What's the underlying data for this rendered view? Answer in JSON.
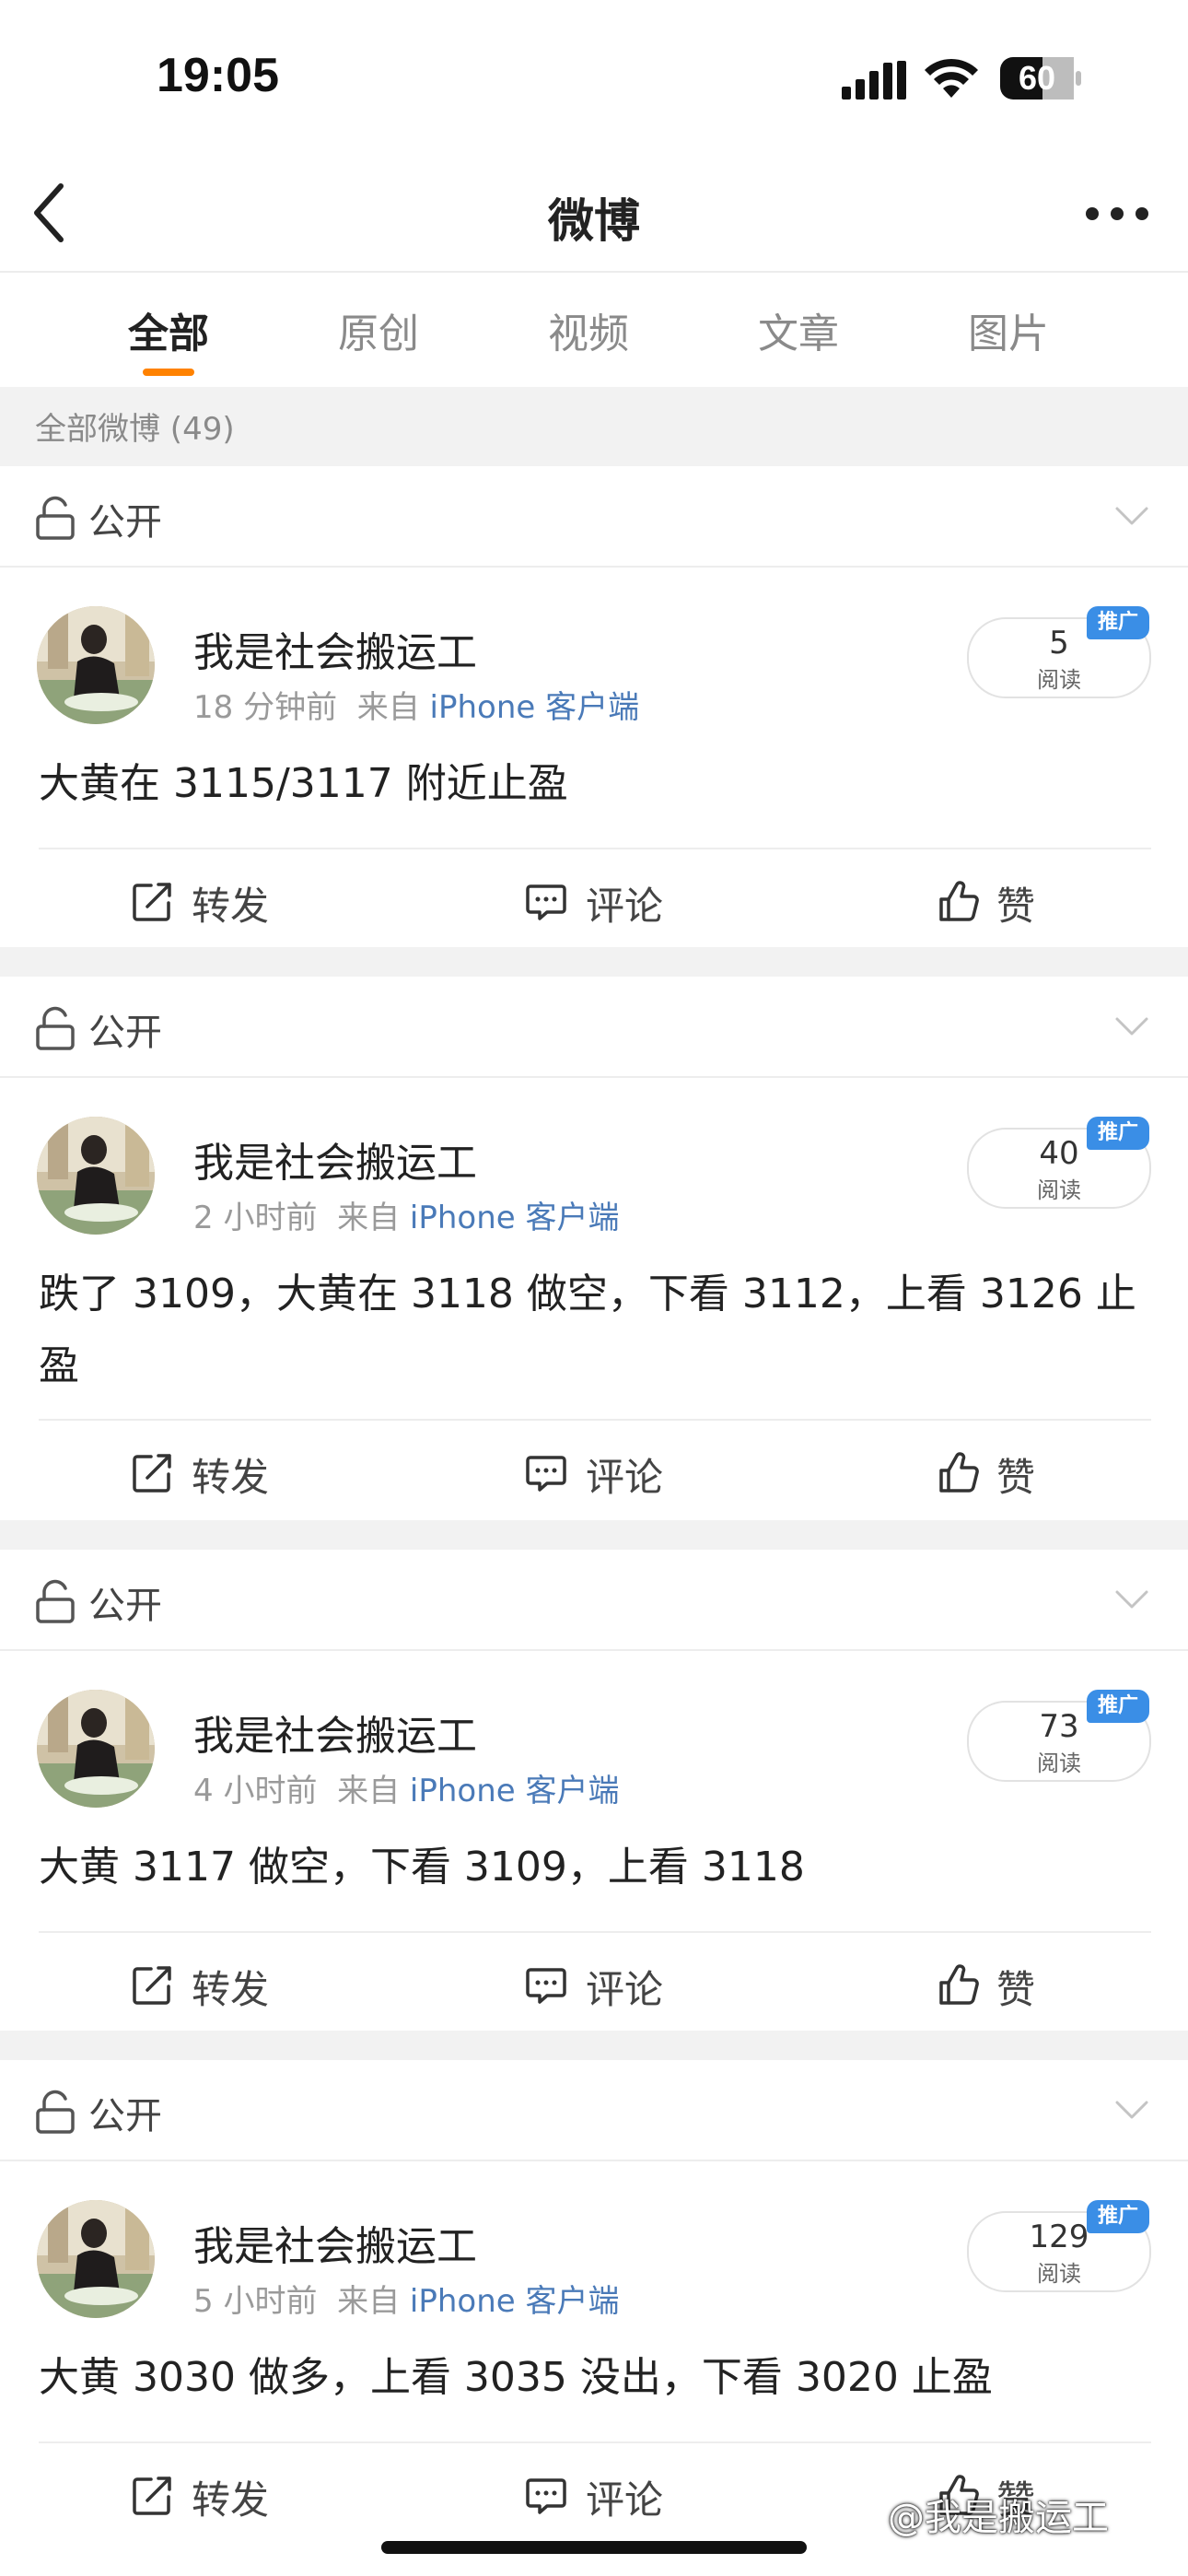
{
  "status_bar": {
    "time": "19:05",
    "battery": "60"
  },
  "nav": {
    "title": "微博"
  },
  "tabs": [
    {
      "label": "全部",
      "active": true
    },
    {
      "label": "原创",
      "active": false
    },
    {
      "label": "视频",
      "active": false
    },
    {
      "label": "文章",
      "active": false
    },
    {
      "label": "图片",
      "active": false
    }
  ],
  "count_label": "全部微博 (49)",
  "posts": [
    {
      "visibility": "公开",
      "user": "我是社会搬运工",
      "time": "18 分钟前",
      "from": "来自",
      "source": "iPhone 客户端",
      "reads": "5",
      "read_label": "阅读",
      "promo": "推广",
      "text": "大黄在 3115/3117 附近止盈",
      "actions": {
        "repost": "转发",
        "comment": "评论",
        "like": "赞"
      }
    },
    {
      "visibility": "公开",
      "user": "我是社会搬运工",
      "time": "2 小时前",
      "from": "来自",
      "source": "iPhone 客户端",
      "reads": "40",
      "read_label": "阅读",
      "promo": "推广",
      "text": "跌了 3109，大黄在 3118 做空，下看 3112，上看 3126 止盈",
      "actions": {
        "repost": "转发",
        "comment": "评论",
        "like": "赞"
      }
    },
    {
      "visibility": "公开",
      "user": "我是社会搬运工",
      "time": "4 小时前",
      "from": "来自",
      "source": "iPhone 客户端",
      "reads": "73",
      "read_label": "阅读",
      "promo": "推广",
      "text": "大黄 3117 做空，下看 3109，上看 3118",
      "actions": {
        "repost": "转发",
        "comment": "评论",
        "like": "赞"
      }
    },
    {
      "visibility": "公开",
      "user": "我是社会搬运工",
      "time": "5 小时前",
      "from": "来自",
      "source": "iPhone 客户端",
      "reads": "129",
      "read_label": "阅读",
      "promo": "推广",
      "text": "大黄 3030 做多，上看 3035 没出，下看 3020 止盈",
      "actions": {
        "repost": "转发",
        "comment": "评论",
        "like": "赞"
      }
    }
  ],
  "watermark": "@我是搬运工",
  "colors": {
    "accent": "#ff8200",
    "link": "#4a7ab8",
    "promo": "#3a8ee6"
  }
}
